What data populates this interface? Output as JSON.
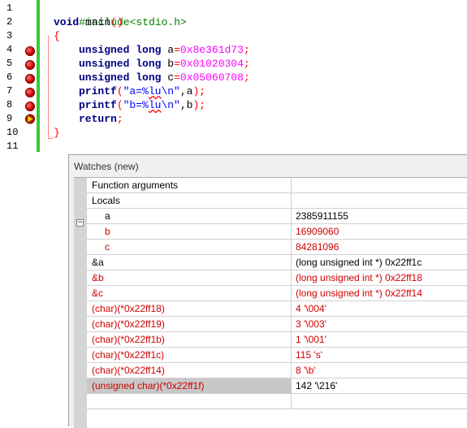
{
  "editor": {
    "line_numbers": [
      "1",
      "2",
      "3",
      "4",
      "5",
      "6",
      "7",
      "8",
      "9",
      "10",
      "11"
    ],
    "lines": {
      "l1": {
        "a": "#include<stdio.h>"
      },
      "l2": {
        "kw": "void",
        "a": " main",
        "op": "()"
      },
      "l3": {
        "op": "{"
      },
      "l4": {
        "kw1": "unsigned",
        "kw2": "long",
        "var": "a",
        "eq": "=",
        "num": "0x8e361d73",
        "semi": ";"
      },
      "l5": {
        "kw1": "unsigned",
        "kw2": "long",
        "var": "b",
        "eq": "=",
        "num": "0x01020304",
        "semi": ";"
      },
      "l6": {
        "kw1": "unsigned",
        "kw2": "long",
        "var": "c",
        "eq": "=",
        "num": "0x05060708",
        "semi": ";"
      },
      "l7": {
        "fn": "printf",
        "op1": "(",
        "s1": "\"a=%",
        "s2": "lu",
        "s3": "\\n\"",
        "rest": ",a",
        "op2": ");"
      },
      "l8": {
        "fn": "printf",
        "op1": "(",
        "s1": "\"b=%",
        "s2": "lu",
        "s3": "\\n\"",
        "rest": ",b",
        "op2": ");"
      },
      "l9": {
        "kw": "return",
        "semi": ";"
      },
      "l10": {
        "op": "}"
      }
    },
    "breakpoint_lines": [
      "4",
      "5",
      "6",
      "7",
      "8"
    ],
    "current_line": "9"
  },
  "watches": {
    "title": "Watches (new)",
    "rows": [
      {
        "name": "Function arguments",
        "value": ""
      },
      {
        "name": "Locals",
        "value": ""
      },
      {
        "name": "a",
        "value": "2385911155"
      },
      {
        "name": "b",
        "value": "16909060"
      },
      {
        "name": "c",
        "value": "84281096"
      },
      {
        "name": "&a",
        "value": "(long unsigned int *) 0x22ff1c"
      },
      {
        "name": "&b",
        "value": "(long unsigned int *) 0x22ff18"
      },
      {
        "name": "&c",
        "value": "(long unsigned int *) 0x22ff14"
      },
      {
        "name": "(char)(*0x22ff18)",
        "value": "4 '\\004'"
      },
      {
        "name": "(char)(*0x22ff19)",
        "value": "3 '\\003'"
      },
      {
        "name": "(char)(*0x22ff1b)",
        "value": "1 '\\001'"
      },
      {
        "name": "(char)(*0x22ff1c)",
        "value": "115 's'"
      },
      {
        "name": "(char)(*0x22ff14)",
        "value": "8 '\\b'"
      },
      {
        "name": "(unsigned char)(*0x22ff1f)",
        "value": "142 '\\216'"
      },
      {
        "name": "",
        "value": ""
      }
    ],
    "expander_symbol": "−"
  },
  "colors": {
    "keyword": "#000080",
    "preprocessor": "#008000",
    "number": "#ff00ff",
    "string": "#0000ff",
    "operator": "#ff0000",
    "changed_value": "#d00000",
    "gutter_bar": "#33cc33"
  }
}
